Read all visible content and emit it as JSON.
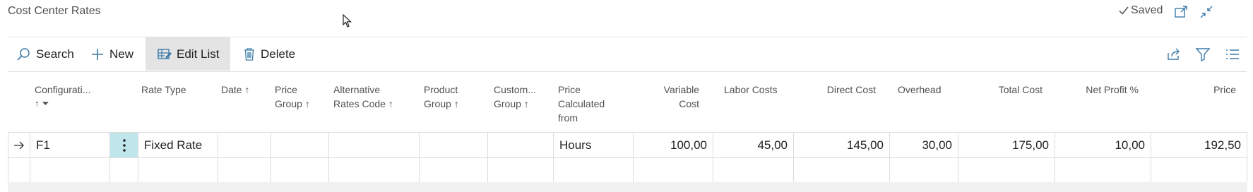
{
  "page": {
    "title": "Cost Center Rates",
    "status": "Saved"
  },
  "toolbar": {
    "search": "Search",
    "new": "New",
    "edit_list": "Edit List",
    "delete": "Delete"
  },
  "columns": [
    {
      "line1": "",
      "line2": "Configurati...",
      "line3": "↑ ⏷"
    },
    {
      "line1": "",
      "line2": "",
      "line3": "Rate Type"
    },
    {
      "line1": "",
      "line2": "",
      "line3": "Date ↑"
    },
    {
      "line1": "",
      "line2": "Price",
      "line3": "Group ↑"
    },
    {
      "line1": "",
      "line2": "Alternative",
      "line3": "Rates Code ↑"
    },
    {
      "line1": "",
      "line2": "Product",
      "line3": "Group ↑"
    },
    {
      "line1": "",
      "line2": "Custom...",
      "line3": "Group ↑"
    },
    {
      "line1": "Price",
      "line2": "Calculated",
      "line3": "from"
    },
    {
      "line1": "",
      "line2": "Variable",
      "line3": "Cost"
    },
    {
      "line1": "",
      "line2": "",
      "line3": "Labor Costs"
    },
    {
      "line1": "",
      "line2": "",
      "line3": "Direct Cost"
    },
    {
      "line1": "",
      "line2": "",
      "line3": "Overhead"
    },
    {
      "line1": "",
      "line2": "",
      "line3": "Total Cost"
    },
    {
      "line1": "",
      "line2": "",
      "line3": "Net Profit %"
    },
    {
      "line1": "",
      "line2": "",
      "line3": "Price"
    }
  ],
  "rows": [
    {
      "configuration": "F1",
      "rate_type": "Fixed Rate",
      "date": "",
      "price_group": "",
      "alt_rates_code": "",
      "product_group": "",
      "customer_group": "",
      "price_calc_from": "Hours",
      "variable_cost": "100,00",
      "labor_costs": "45,00",
      "direct_cost": "145,00",
      "overhead": "30,00",
      "total_cost": "175,00",
      "net_profit_pct": "10,00",
      "price": "192,50"
    }
  ],
  "colors": {
    "accent": "#3b7aa8",
    "selected_cell": "#bfe6ea",
    "row_border": "#dcdcdc"
  },
  "icons": [
    "arrow-right-icon",
    "more-vertical-icon",
    "search-icon",
    "plus-icon",
    "edit-list-icon",
    "delete-icon",
    "share-icon",
    "filter-icon",
    "list-view-icon",
    "open-new-window-icon",
    "collapse-icon",
    "checkmark-icon"
  ]
}
